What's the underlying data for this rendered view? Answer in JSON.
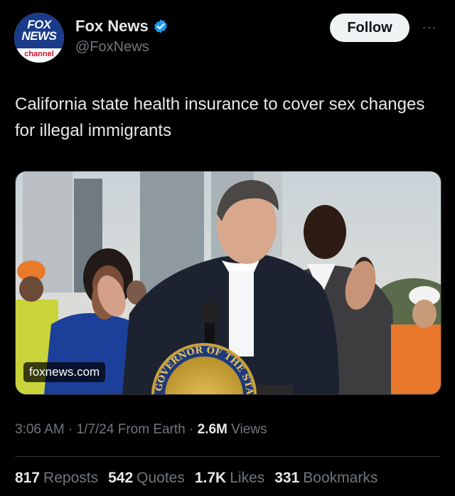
{
  "author": {
    "name": "Fox News",
    "handle": "@FoxNews",
    "avatar_line1": "FOX",
    "avatar_line2": "NEWS",
    "avatar_line3": "channel",
    "verified_color": "#1d9bf0"
  },
  "follow_label": "Follow",
  "more_label": "···",
  "tweet": {
    "text": "California state health insurance to cover sex changes for illegal immigrants"
  },
  "media": {
    "domain": "foxnews.com",
    "seal_text": "GOVERNOR OF THE STATE OF C"
  },
  "meta": {
    "time": "3:06 AM",
    "sep1": " · ",
    "date": "1/7/24",
    "source": " From Earth",
    "sep2": " · ",
    "views_count": "2.6M",
    "views_label": " Views"
  },
  "stats": [
    {
      "count": "817",
      "label": "Reposts"
    },
    {
      "count": "542",
      "label": "Quotes"
    },
    {
      "count": "1.7K",
      "label": "Likes"
    },
    {
      "count": "331",
      "label": "Bookmarks"
    }
  ]
}
